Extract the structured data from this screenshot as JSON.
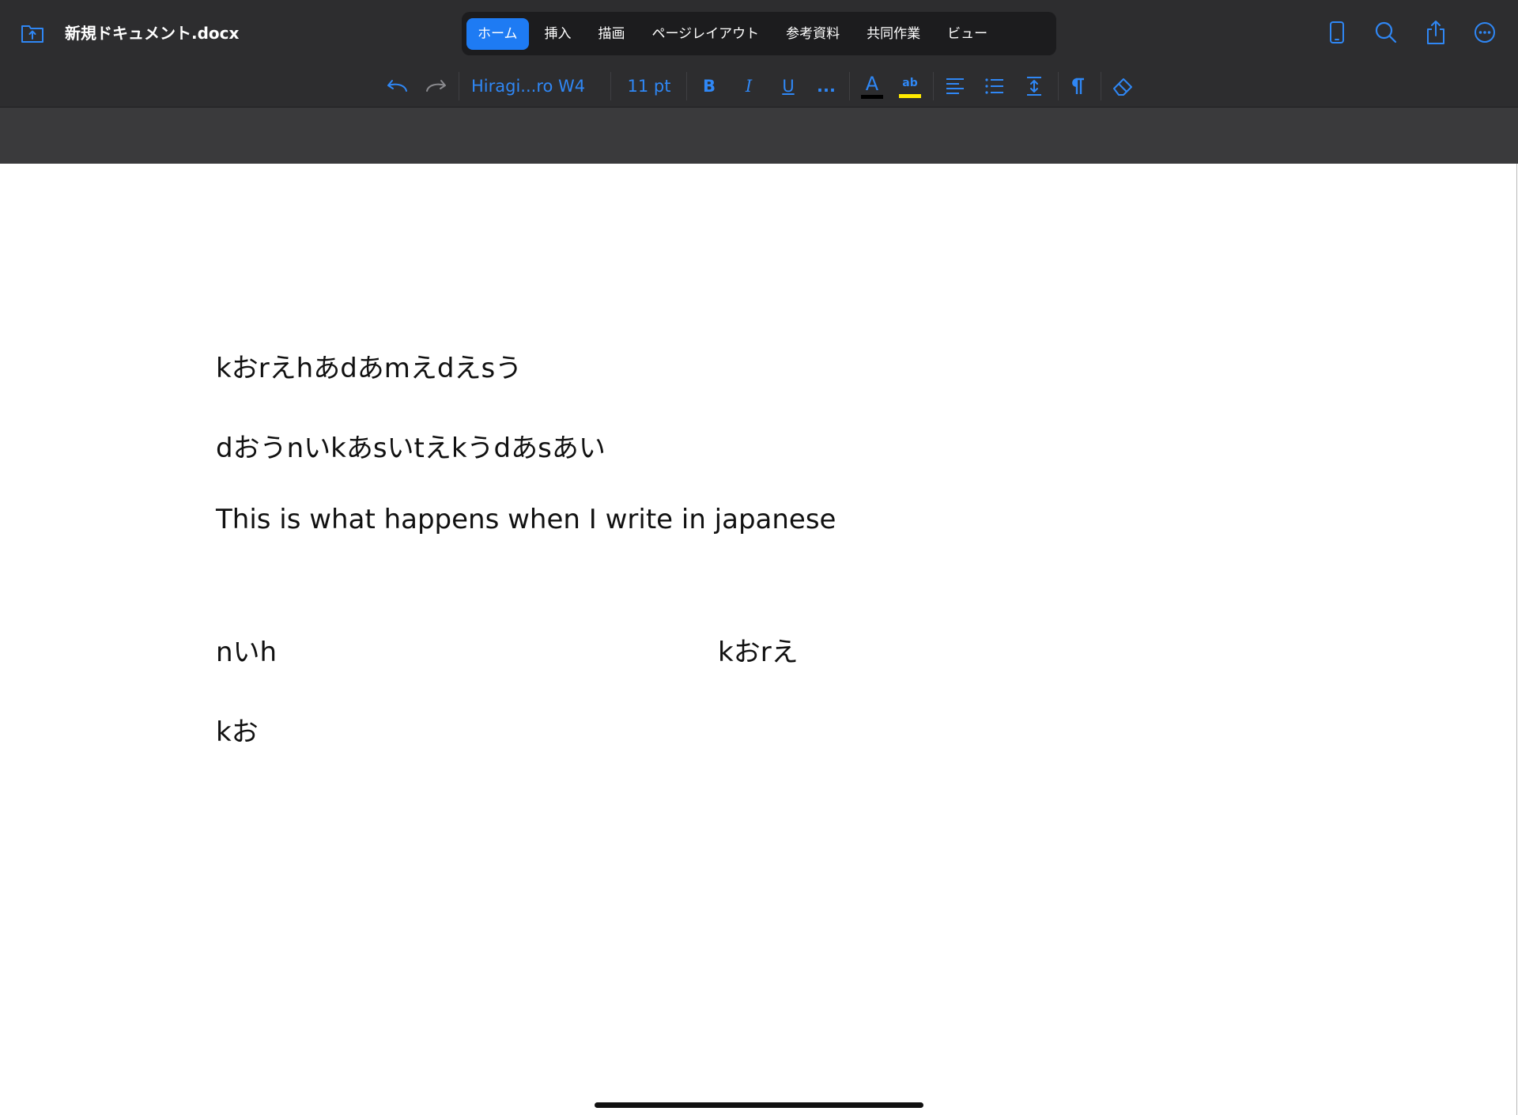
{
  "app": {
    "document_title": "新規ドキュメント.docx"
  },
  "tabs": [
    {
      "label": "ホーム",
      "active": true
    },
    {
      "label": "挿入",
      "active": false
    },
    {
      "label": "描画",
      "active": false
    },
    {
      "label": "ページレイアウト",
      "active": false
    },
    {
      "label": "参考資料",
      "active": false
    },
    {
      "label": "共同作業",
      "active": false
    },
    {
      "label": "ビュー",
      "active": false
    }
  ],
  "top_right_icons": [
    "phone-view-icon",
    "search-icon",
    "share-icon",
    "more-icon"
  ],
  "toolbar": {
    "font_name": "Hiragi...ro W4",
    "font_size": "11 pt",
    "bold_label": "B",
    "italic_label": "I",
    "underline_label": "U",
    "more_label": "...",
    "font_color_label": "A",
    "highlight_label": "ab",
    "font_color": "#000000",
    "highlight_color": "#ffea00",
    "accent_color": "#2f87f5"
  },
  "document": {
    "lines": [
      "kおrえhあdあmえdえsう",
      "dおうnいkあsいtえkうdあsあい",
      "This is what happens when I write in japanese",
      "nいh",
      "kおrえ",
      "kお"
    ]
  },
  "colors": {
    "chrome_dark": "#2d2d2f",
    "tab_bar_bg": "#1c1c1e",
    "active_tab": "#1e7bf3",
    "gray_band": "#3a3a3c",
    "page": "#ffffff"
  }
}
